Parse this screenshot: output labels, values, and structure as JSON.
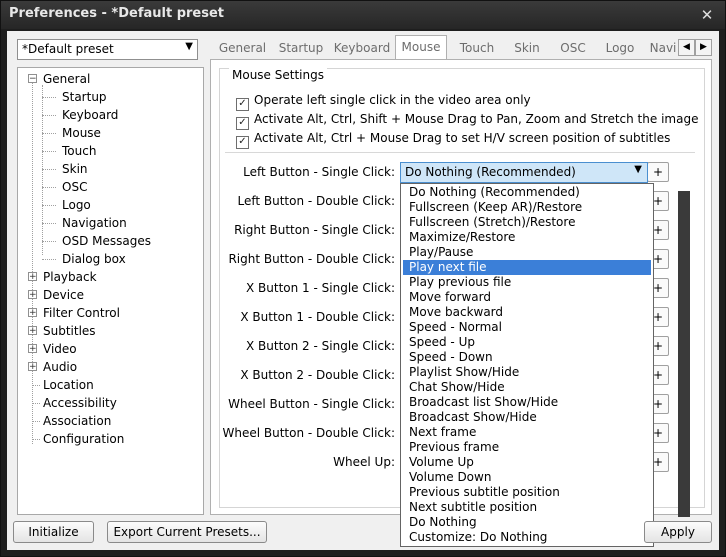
{
  "window": {
    "title": "Preferences - *Default preset",
    "close_glyph": "✕"
  },
  "preset": {
    "value": "*Default preset"
  },
  "tree": {
    "general": "General",
    "general_children": [
      "Startup",
      "Keyboard",
      "Mouse",
      "Touch",
      "Skin",
      "OSC",
      "Logo",
      "Navigation",
      "OSD Messages",
      "Dialog box"
    ],
    "collapsed": [
      "Playback",
      "Device",
      "Filter Control",
      "Subtitles",
      "Video",
      "Audio"
    ],
    "leaves": [
      "Location",
      "Accessibility",
      "Association",
      "Configuration"
    ]
  },
  "tabs": [
    "General",
    "Startup",
    "Keyboard",
    "Mouse",
    "Touch",
    "Skin",
    "OSC",
    "Logo",
    "Navi"
  ],
  "group": {
    "label": "Mouse Settings",
    "checks": [
      "Operate left single click in the video area only",
      "Activate Alt, Ctrl, Shift + Mouse Drag to Pan, Zoom and Stretch the image",
      "Activate Alt, Ctrl + Mouse Drag to set H/V screen position of subtitles"
    ]
  },
  "rows": [
    "Left Button - Single Click:",
    "Left Button - Double Click:",
    "Right Button - Single Click:",
    "Right Button - Double Click:",
    "X Button 1 - Single Click:",
    "X Button 1 - Double Click:",
    "X Button 2 - Single Click:",
    "X Button 2 - Double Click:",
    "Wheel Button - Single Click:",
    "Wheel Button - Double Click:",
    "Wheel Up:"
  ],
  "selected_action": "Do Nothing (Recommended)",
  "plus": "+",
  "dropdown": [
    "Do Nothing (Recommended)",
    "Fullscreen (Keep AR)/Restore",
    "Fullscreen (Stretch)/Restore",
    "Maximize/Restore",
    "Play/Pause",
    "Play next file",
    "Play previous file",
    "Move forward",
    "Move backward",
    "Speed - Normal",
    "Speed - Up",
    "Speed - Down",
    "Playlist Show/Hide",
    "Chat Show/Hide",
    "Broadcast list Show/Hide",
    "Broadcast Show/Hide",
    "Next frame",
    "Previous frame",
    "Volume Up",
    "Volume Down",
    "Previous subtitle position",
    "Next subtitle position",
    "Do Nothing",
    "Customize: Do Nothing"
  ],
  "buttons": {
    "initialize": "Initialize",
    "export": "Export Current Presets...",
    "apply": "Apply"
  }
}
